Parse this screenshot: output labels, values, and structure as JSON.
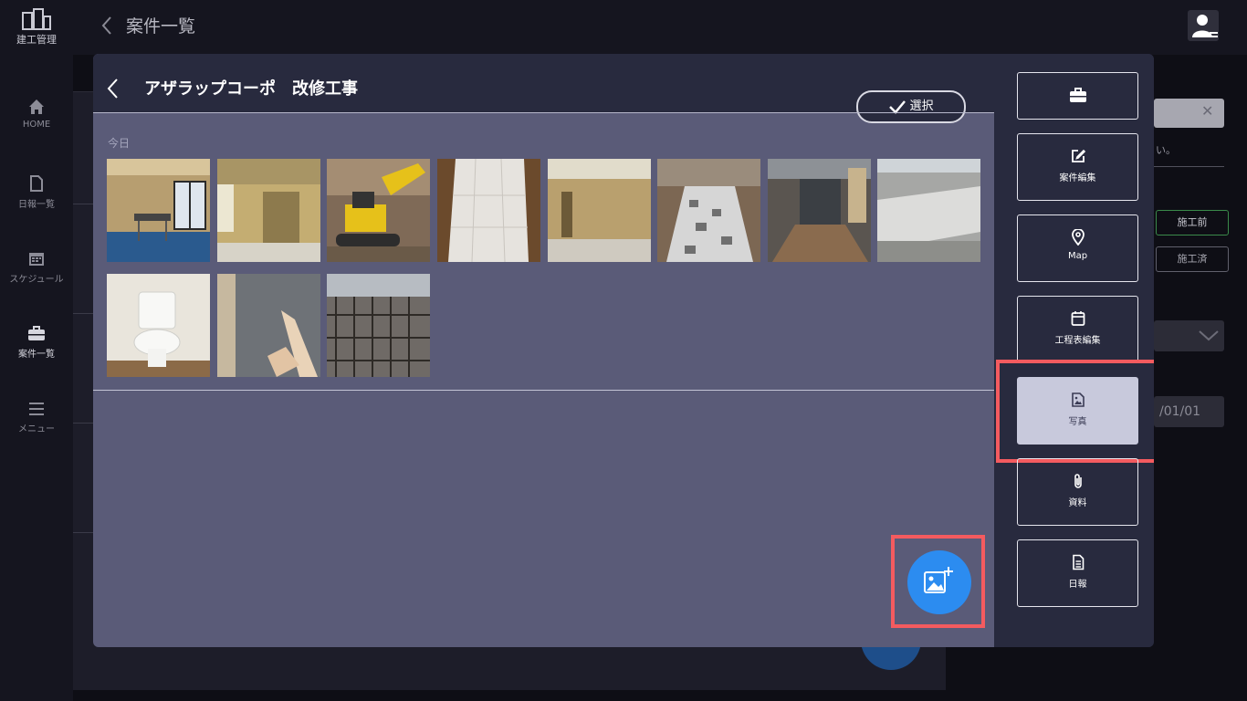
{
  "app": {
    "logo_text": "建工管理",
    "header_title": "案件一覧"
  },
  "sidebar": {
    "items": [
      {
        "label": "HOME",
        "icon": "home-icon"
      },
      {
        "label": "日報一覧",
        "icon": "document-icon"
      },
      {
        "label": "スケジュール",
        "icon": "calendar-icon"
      },
      {
        "label": "案件一覧",
        "icon": "briefcase-icon"
      },
      {
        "label": "メニュー",
        "icon": "menu-icon"
      }
    ]
  },
  "background_form": {
    "note_text": "い。",
    "chip_before": "施工前",
    "chip_done": "施工済",
    "date_value": "/01/01"
  },
  "modal": {
    "project_title": "アザラップコーポ　改修工事",
    "select_button_label": "選択",
    "date_group_label": "今日",
    "photos": [
      {
        "alt": "drywall-room-with-window"
      },
      {
        "alt": "room-interior-doorway"
      },
      {
        "alt": "yellow-excavator"
      },
      {
        "alt": "tiled-entrance"
      },
      {
        "alt": "interior-renovation-room"
      },
      {
        "alt": "paved-walkway"
      },
      {
        "alt": "building-entrance-path"
      },
      {
        "alt": "concrete-foundation"
      },
      {
        "alt": "toilet"
      },
      {
        "alt": "wallpaper-installation"
      },
      {
        "alt": "rebar-construction-site"
      }
    ],
    "fab_icon": "add-photo-icon"
  },
  "actions": [
    {
      "label": "",
      "icon": "briefcase-icon"
    },
    {
      "label": "案件編集",
      "icon": "edit-icon"
    },
    {
      "label": "Map",
      "icon": "map-pin-icon"
    },
    {
      "label": "工程表編集",
      "icon": "calendar-icon"
    },
    {
      "label": "写真",
      "icon": "image-icon",
      "active": true
    },
    {
      "label": "資料",
      "icon": "paperclip-icon"
    },
    {
      "label": "日報",
      "icon": "document-icon"
    }
  ],
  "colors": {
    "overlay_bg": "#0e0e15",
    "modal_bg": "#282a3e",
    "gallery_bg": "#5a5b78",
    "fab": "#2c8cf0",
    "highlight": "#f45b5f"
  }
}
